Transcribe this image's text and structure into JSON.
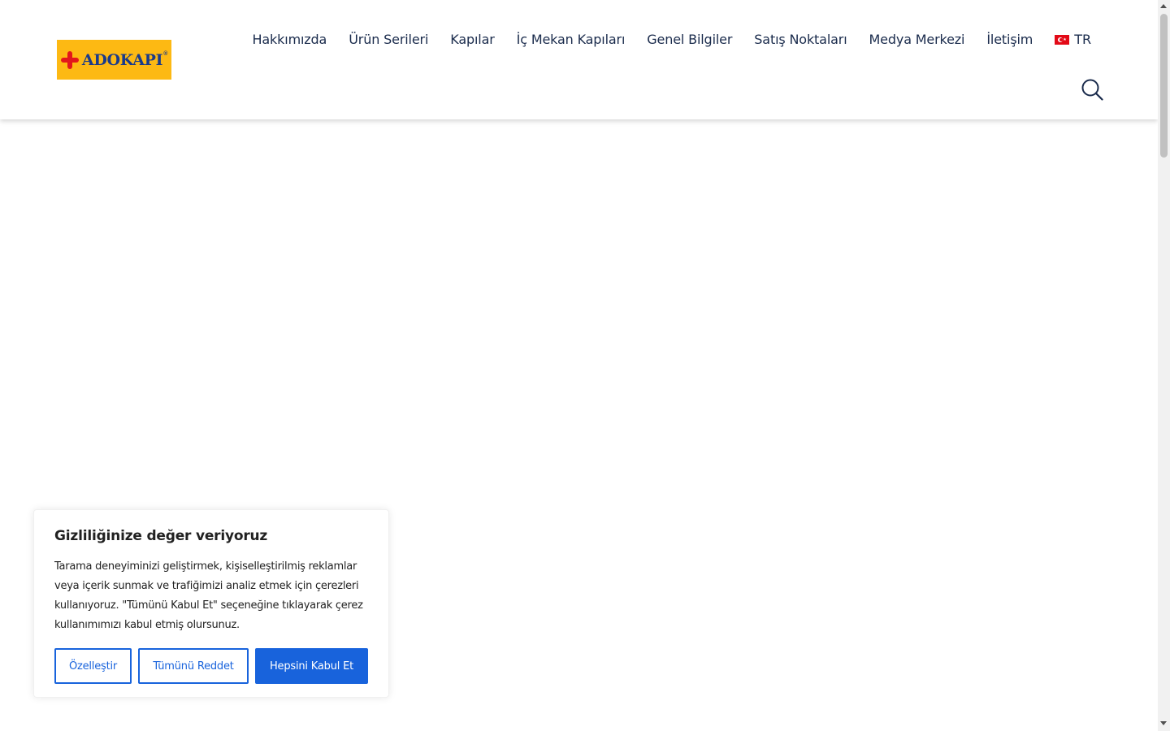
{
  "colors": {
    "nav_text": "#1a2b4c",
    "logo_bg": "#fdb913",
    "logo_text": "#1a3a8a",
    "logo_mark": "#e3171b",
    "flag_red": "#e30a17",
    "accent_blue": "#1863dc",
    "body_text": "#212121",
    "title_text": "#212121"
  },
  "header": {
    "logo": {
      "text": "ADOKAPI",
      "registered": "®",
      "icon": "brand-cross-icon"
    },
    "nav": [
      "Hakkımızda",
      "Ürün Serileri",
      "Kapılar",
      "İç Mekan Kapıları",
      "Genel Bilgiler",
      "Satış Noktaları",
      "Medya Merkezi",
      "İletişim"
    ],
    "language": {
      "code": "TR",
      "icon": "turkey-flag-icon"
    },
    "search": {
      "icon": "search-icon"
    }
  },
  "cookie_banner": {
    "title": "Gizliliğinize değer veriyoruz",
    "text": "Tarama deneyiminizi geliştirmek, kişiselleştirilmiş reklamlar veya içerik sunmak ve trafiğimizi analiz etmek için çerezleri kullanıyoruz. \"Tümünü Kabul Et\" seçeneğine tıklayarak çerez kullanımımızı kabul etmiş olursunuz.",
    "buttons": {
      "customize": "Özelleştir",
      "reject": "Tümünü Reddet",
      "accept": "Hepsini Kabul Et"
    }
  }
}
